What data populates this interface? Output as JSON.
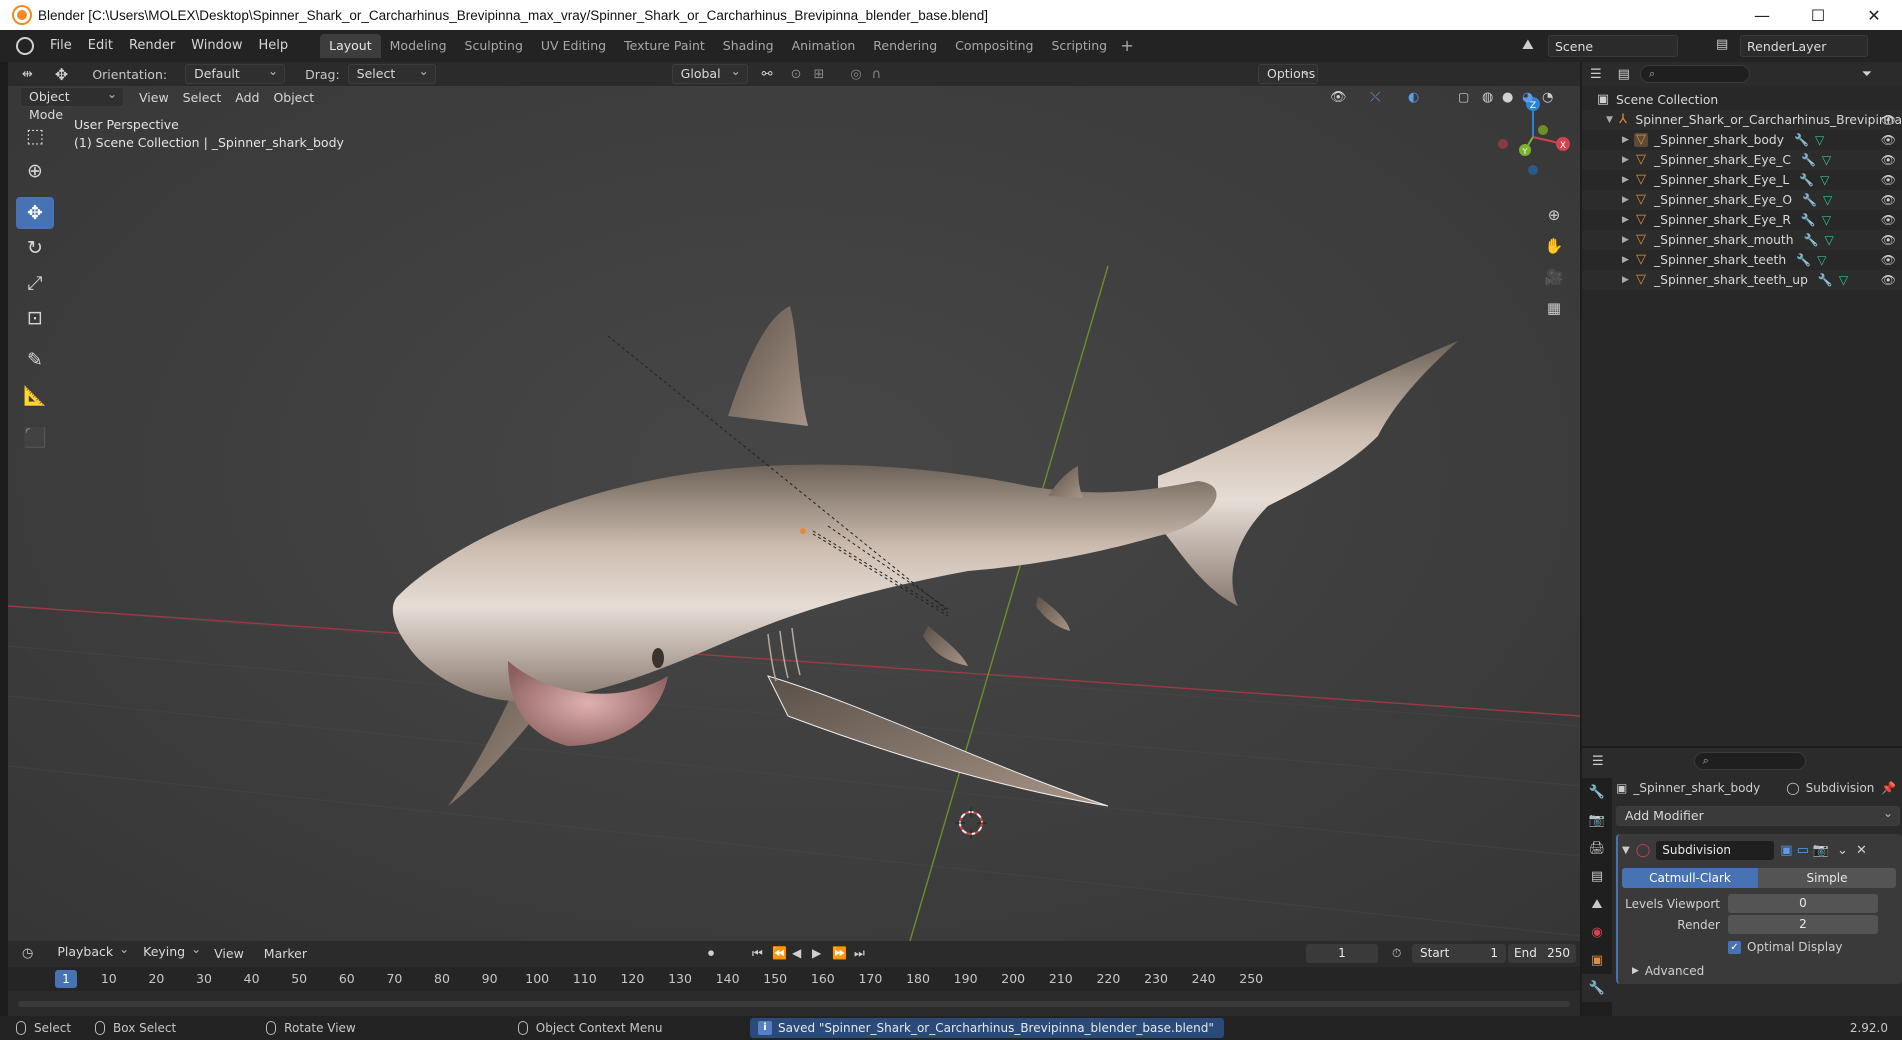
{
  "window": {
    "title": "Blender [C:\\Users\\MOLEX\\Desktop\\Spinner_Shark_or_Carcharhinus_Brevipinna_max_vray/Spinner_Shark_or_Carcharhinus_Brevipinna_blender_base.blend]",
    "controls": [
      "—",
      "☐",
      "✕"
    ]
  },
  "menu": [
    "File",
    "Edit",
    "Render",
    "Window",
    "Help"
  ],
  "workspaces": [
    "Layout",
    "Modeling",
    "Sculpting",
    "UV Editing",
    "Texture Paint",
    "Shading",
    "Animation",
    "Rendering",
    "Compositing",
    "Scripting"
  ],
  "active_workspace": "Layout",
  "scene": "Scene",
  "view_layer": "RenderLayer",
  "viewport_header": {
    "orientation_label": "Orientation:",
    "orientation_value": "Default",
    "drag_label": "Drag:",
    "drag_value": "Select Box",
    "transform_space": "Global",
    "options": "Options",
    "mode": "Object Mode",
    "view": "View",
    "select": "Select",
    "add": "Add",
    "object": "Object"
  },
  "viewport_info": {
    "perspective": "User Perspective",
    "collection": "(1) Scene Collection | _Spinner_shark_body"
  },
  "gizmo_axes": {
    "z": "Z",
    "x": "X",
    "y": "Y"
  },
  "colors": {
    "accent": "#4772b3",
    "mesh_icon": "#e38b3b",
    "x_axis": "#d0434f",
    "y_axis": "#7cb32f",
    "z_axis": "#2d84d6"
  },
  "outliner": {
    "root": "Scene Collection",
    "collection": "Spinner_Shark_or_Carcharhinus_Brevipinna",
    "objects": [
      "_Spinner_shark_body",
      "_Spinner_shark_Eye_C",
      "_Spinner_shark_Eye_L",
      "_Spinner_shark_Eye_O",
      "_Spinner_shark_Eye_R",
      "_Spinner_shark_mouth",
      "_Spinner_shark_teeth",
      "_Spinner_shark_teeth_up"
    ]
  },
  "properties": {
    "object": "_Spinner_shark_body",
    "modifier_tab": "Subdivision",
    "add_modifier": "Add Modifier",
    "modifier_name": "Subdivision",
    "algo_a": "Catmull-Clark",
    "algo_b": "Simple",
    "levels_viewport_label": "Levels Viewport",
    "levels_viewport": "0",
    "render_label": "Render",
    "render": "2",
    "optimal_display": "Optimal Display",
    "advanced": "Advanced"
  },
  "timeline": {
    "playback": "Playback",
    "keying": "Keying",
    "view": "View",
    "marker": "Marker",
    "current_frame": "1",
    "start_label": "Start",
    "start": "1",
    "end_label": "End",
    "end": "250",
    "ticks": [
      "1",
      "10",
      "20",
      "30",
      "40",
      "50",
      "60",
      "70",
      "80",
      "90",
      "100",
      "110",
      "120",
      "130",
      "140",
      "150",
      "160",
      "170",
      "180",
      "190",
      "200",
      "210",
      "220",
      "230",
      "240",
      "250"
    ]
  },
  "statusbar": {
    "select": "Select",
    "box_select": "Box Select",
    "rotate_view": "Rotate View",
    "context_menu": "Object Context Menu",
    "message": "Saved \"Spinner_Shark_or_Carcharhinus_Brevipinna_blender_base.blend\"",
    "version": "2.92.0"
  }
}
